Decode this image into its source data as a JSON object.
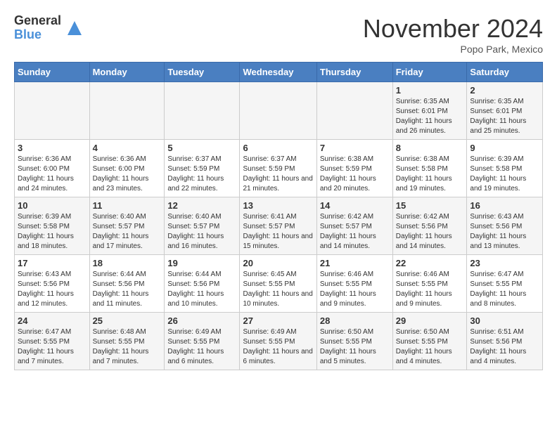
{
  "header": {
    "logo_general": "General",
    "logo_blue": "Blue",
    "month_title": "November 2024",
    "subtitle": "Popo Park, Mexico"
  },
  "days_of_week": [
    "Sunday",
    "Monday",
    "Tuesday",
    "Wednesday",
    "Thursday",
    "Friday",
    "Saturday"
  ],
  "weeks": [
    [
      {
        "day": "",
        "info": ""
      },
      {
        "day": "",
        "info": ""
      },
      {
        "day": "",
        "info": ""
      },
      {
        "day": "",
        "info": ""
      },
      {
        "day": "",
        "info": ""
      },
      {
        "day": "1",
        "info": "Sunrise: 6:35 AM\nSunset: 6:01 PM\nDaylight: 11 hours and 26 minutes."
      },
      {
        "day": "2",
        "info": "Sunrise: 6:35 AM\nSunset: 6:01 PM\nDaylight: 11 hours and 25 minutes."
      }
    ],
    [
      {
        "day": "3",
        "info": "Sunrise: 6:36 AM\nSunset: 6:00 PM\nDaylight: 11 hours and 24 minutes."
      },
      {
        "day": "4",
        "info": "Sunrise: 6:36 AM\nSunset: 6:00 PM\nDaylight: 11 hours and 23 minutes."
      },
      {
        "day": "5",
        "info": "Sunrise: 6:37 AM\nSunset: 5:59 PM\nDaylight: 11 hours and 22 minutes."
      },
      {
        "day": "6",
        "info": "Sunrise: 6:37 AM\nSunset: 5:59 PM\nDaylight: 11 hours and 21 minutes."
      },
      {
        "day": "7",
        "info": "Sunrise: 6:38 AM\nSunset: 5:59 PM\nDaylight: 11 hours and 20 minutes."
      },
      {
        "day": "8",
        "info": "Sunrise: 6:38 AM\nSunset: 5:58 PM\nDaylight: 11 hours and 19 minutes."
      },
      {
        "day": "9",
        "info": "Sunrise: 6:39 AM\nSunset: 5:58 PM\nDaylight: 11 hours and 19 minutes."
      }
    ],
    [
      {
        "day": "10",
        "info": "Sunrise: 6:39 AM\nSunset: 5:58 PM\nDaylight: 11 hours and 18 minutes."
      },
      {
        "day": "11",
        "info": "Sunrise: 6:40 AM\nSunset: 5:57 PM\nDaylight: 11 hours and 17 minutes."
      },
      {
        "day": "12",
        "info": "Sunrise: 6:40 AM\nSunset: 5:57 PM\nDaylight: 11 hours and 16 minutes."
      },
      {
        "day": "13",
        "info": "Sunrise: 6:41 AM\nSunset: 5:57 PM\nDaylight: 11 hours and 15 minutes."
      },
      {
        "day": "14",
        "info": "Sunrise: 6:42 AM\nSunset: 5:57 PM\nDaylight: 11 hours and 14 minutes."
      },
      {
        "day": "15",
        "info": "Sunrise: 6:42 AM\nSunset: 5:56 PM\nDaylight: 11 hours and 14 minutes."
      },
      {
        "day": "16",
        "info": "Sunrise: 6:43 AM\nSunset: 5:56 PM\nDaylight: 11 hours and 13 minutes."
      }
    ],
    [
      {
        "day": "17",
        "info": "Sunrise: 6:43 AM\nSunset: 5:56 PM\nDaylight: 11 hours and 12 minutes."
      },
      {
        "day": "18",
        "info": "Sunrise: 6:44 AM\nSunset: 5:56 PM\nDaylight: 11 hours and 11 minutes."
      },
      {
        "day": "19",
        "info": "Sunrise: 6:44 AM\nSunset: 5:56 PM\nDaylight: 11 hours and 10 minutes."
      },
      {
        "day": "20",
        "info": "Sunrise: 6:45 AM\nSunset: 5:55 PM\nDaylight: 11 hours and 10 minutes."
      },
      {
        "day": "21",
        "info": "Sunrise: 6:46 AM\nSunset: 5:55 PM\nDaylight: 11 hours and 9 minutes."
      },
      {
        "day": "22",
        "info": "Sunrise: 6:46 AM\nSunset: 5:55 PM\nDaylight: 11 hours and 9 minutes."
      },
      {
        "day": "23",
        "info": "Sunrise: 6:47 AM\nSunset: 5:55 PM\nDaylight: 11 hours and 8 minutes."
      }
    ],
    [
      {
        "day": "24",
        "info": "Sunrise: 6:47 AM\nSunset: 5:55 PM\nDaylight: 11 hours and 7 minutes."
      },
      {
        "day": "25",
        "info": "Sunrise: 6:48 AM\nSunset: 5:55 PM\nDaylight: 11 hours and 7 minutes."
      },
      {
        "day": "26",
        "info": "Sunrise: 6:49 AM\nSunset: 5:55 PM\nDaylight: 11 hours and 6 minutes."
      },
      {
        "day": "27",
        "info": "Sunrise: 6:49 AM\nSunset: 5:55 PM\nDaylight: 11 hours and 6 minutes."
      },
      {
        "day": "28",
        "info": "Sunrise: 6:50 AM\nSunset: 5:55 PM\nDaylight: 11 hours and 5 minutes."
      },
      {
        "day": "29",
        "info": "Sunrise: 6:50 AM\nSunset: 5:55 PM\nDaylight: 11 hours and 4 minutes."
      },
      {
        "day": "30",
        "info": "Sunrise: 6:51 AM\nSunset: 5:56 PM\nDaylight: 11 hours and 4 minutes."
      }
    ]
  ]
}
